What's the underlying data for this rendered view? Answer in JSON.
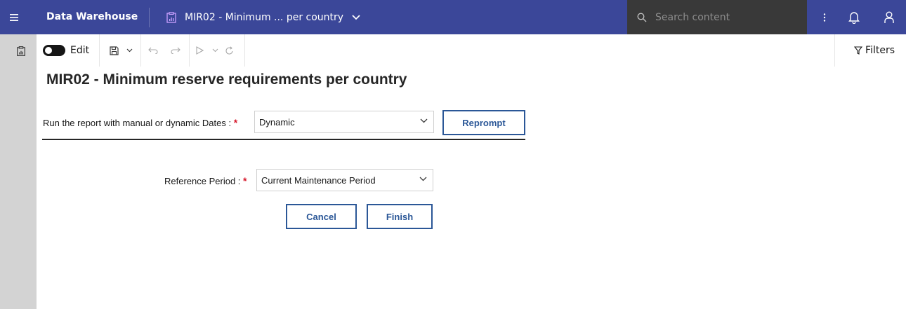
{
  "header": {
    "app_name": "Data Warehouse",
    "tab_title": "MIR02 - Minimum ... per country",
    "search_placeholder": "Search content"
  },
  "toolbar": {
    "edit_label": "Edit",
    "filters_label": "Filters"
  },
  "report": {
    "title": "MIR02 - Minimum reserve requirements per country",
    "date_mode_label": "Run the report with manual or dynamic Dates :",
    "date_mode_value": "Dynamic",
    "reprompt_label": "Reprompt",
    "reference_period_label": "Reference Period :",
    "reference_period_value": "Current Maintenance Period",
    "cancel_label": "Cancel",
    "finish_label": "Finish",
    "required_marker": "*"
  },
  "colors": {
    "header_bg": "#3b4799",
    "search_bg": "#393939",
    "rail_bg": "#d3d3d3",
    "button_accent": "#2b5797",
    "required": "#d6182b"
  }
}
